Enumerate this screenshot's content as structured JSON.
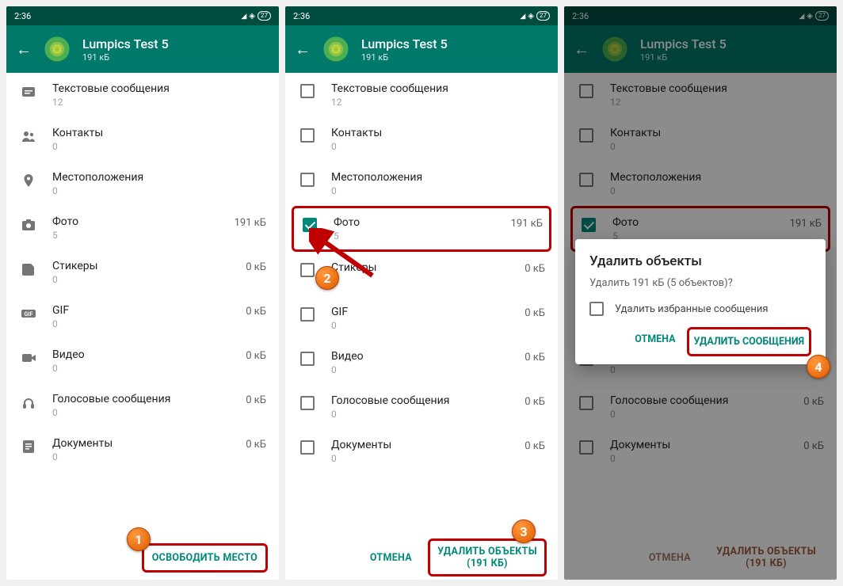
{
  "status": {
    "time": "2:36",
    "battery": "27"
  },
  "header": {
    "title": "Lumpics Test 5",
    "subtitle": "191 кБ"
  },
  "rows": [
    {
      "label": "Текстовые сообщения",
      "count": "12",
      "size": ""
    },
    {
      "label": "Контакты",
      "count": "0",
      "size": ""
    },
    {
      "label": "Местоположения",
      "count": "0",
      "size": ""
    },
    {
      "label": "Фото",
      "count": "5",
      "size": "191 кБ"
    },
    {
      "label": "Стикеры",
      "count": "0",
      "size": "0 кБ"
    },
    {
      "label": "GIF",
      "count": "0",
      "size": "0 кБ"
    },
    {
      "label": "Видео",
      "count": "0",
      "size": "0 кБ"
    },
    {
      "label": "Голосовые сообщения",
      "count": "0",
      "size": "0 кБ"
    },
    {
      "label": "Документы",
      "count": "0",
      "size": "0 кБ"
    }
  ],
  "footer": {
    "free_space": "ОСВОБОДИТЬ МЕСТО",
    "cancel": "ОТМЕНА",
    "delete_objects": "УДАЛИТЬ ОБЪЕКТЫ (191 КБ)"
  },
  "dialog": {
    "title": "Удалить объекты",
    "text": "Удалить 191 кБ (5 объектов)?",
    "option": "Удалить избранные сообщения",
    "cancel": "ОТМЕНА",
    "confirm": "УДАЛИТЬ СООБЩЕНИЯ"
  },
  "steps": {
    "s1": "1",
    "s2": "2",
    "s3": "3",
    "s4": "4"
  }
}
